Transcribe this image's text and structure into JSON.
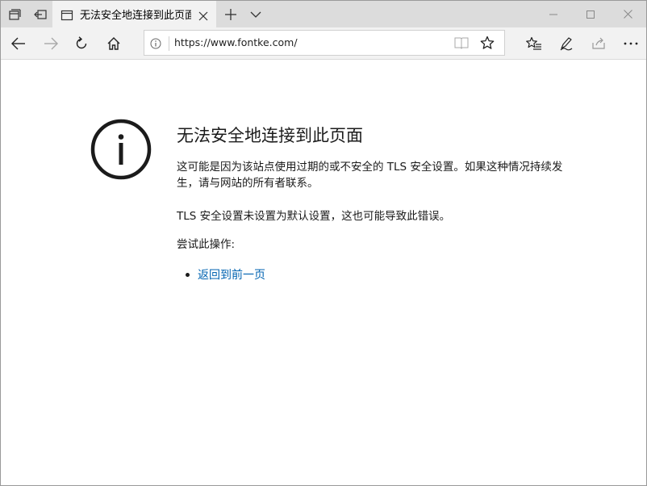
{
  "tab": {
    "title": "无法安全地连接到此页面"
  },
  "address_bar": {
    "url": "https://www.fontke.com/"
  },
  "error_page": {
    "heading": "无法安全地连接到此页面",
    "paragraph1": "这可能是因为该站点使用过期的或不安全的 TLS 安全设置。如果这种情况持续发生，请与网站的所有者联系。",
    "paragraph2": "TLS 安全设置未设置为默认设置，这也可能导致此错误。",
    "try_label": "尝试此操作:",
    "links": [
      "返回到前一页"
    ]
  },
  "colors": {
    "tabbar_bg": "#dcdcdc",
    "toolbar_bg": "#f2f2f2",
    "link": "#0063b1"
  },
  "icons": {
    "tabbar_left": [
      "tabs-aside-icon",
      "tab-preview-icon"
    ],
    "tab": [
      "tab-page-icon",
      "close-icon"
    ],
    "tabbar_right": [
      "plus-icon",
      "chevron-down-icon"
    ],
    "window": [
      "minimize-icon",
      "maximize-icon",
      "close-icon"
    ],
    "nav": [
      "back-arrow-icon",
      "forward-arrow-icon",
      "refresh-icon",
      "home-icon"
    ],
    "address": [
      "info-icon",
      "reading-view-icon",
      "star-icon"
    ],
    "toolbar_right": [
      "favorites-icon",
      "pen-icon",
      "share-icon",
      "more-icon"
    ],
    "content": [
      "info-circle-icon"
    ]
  }
}
